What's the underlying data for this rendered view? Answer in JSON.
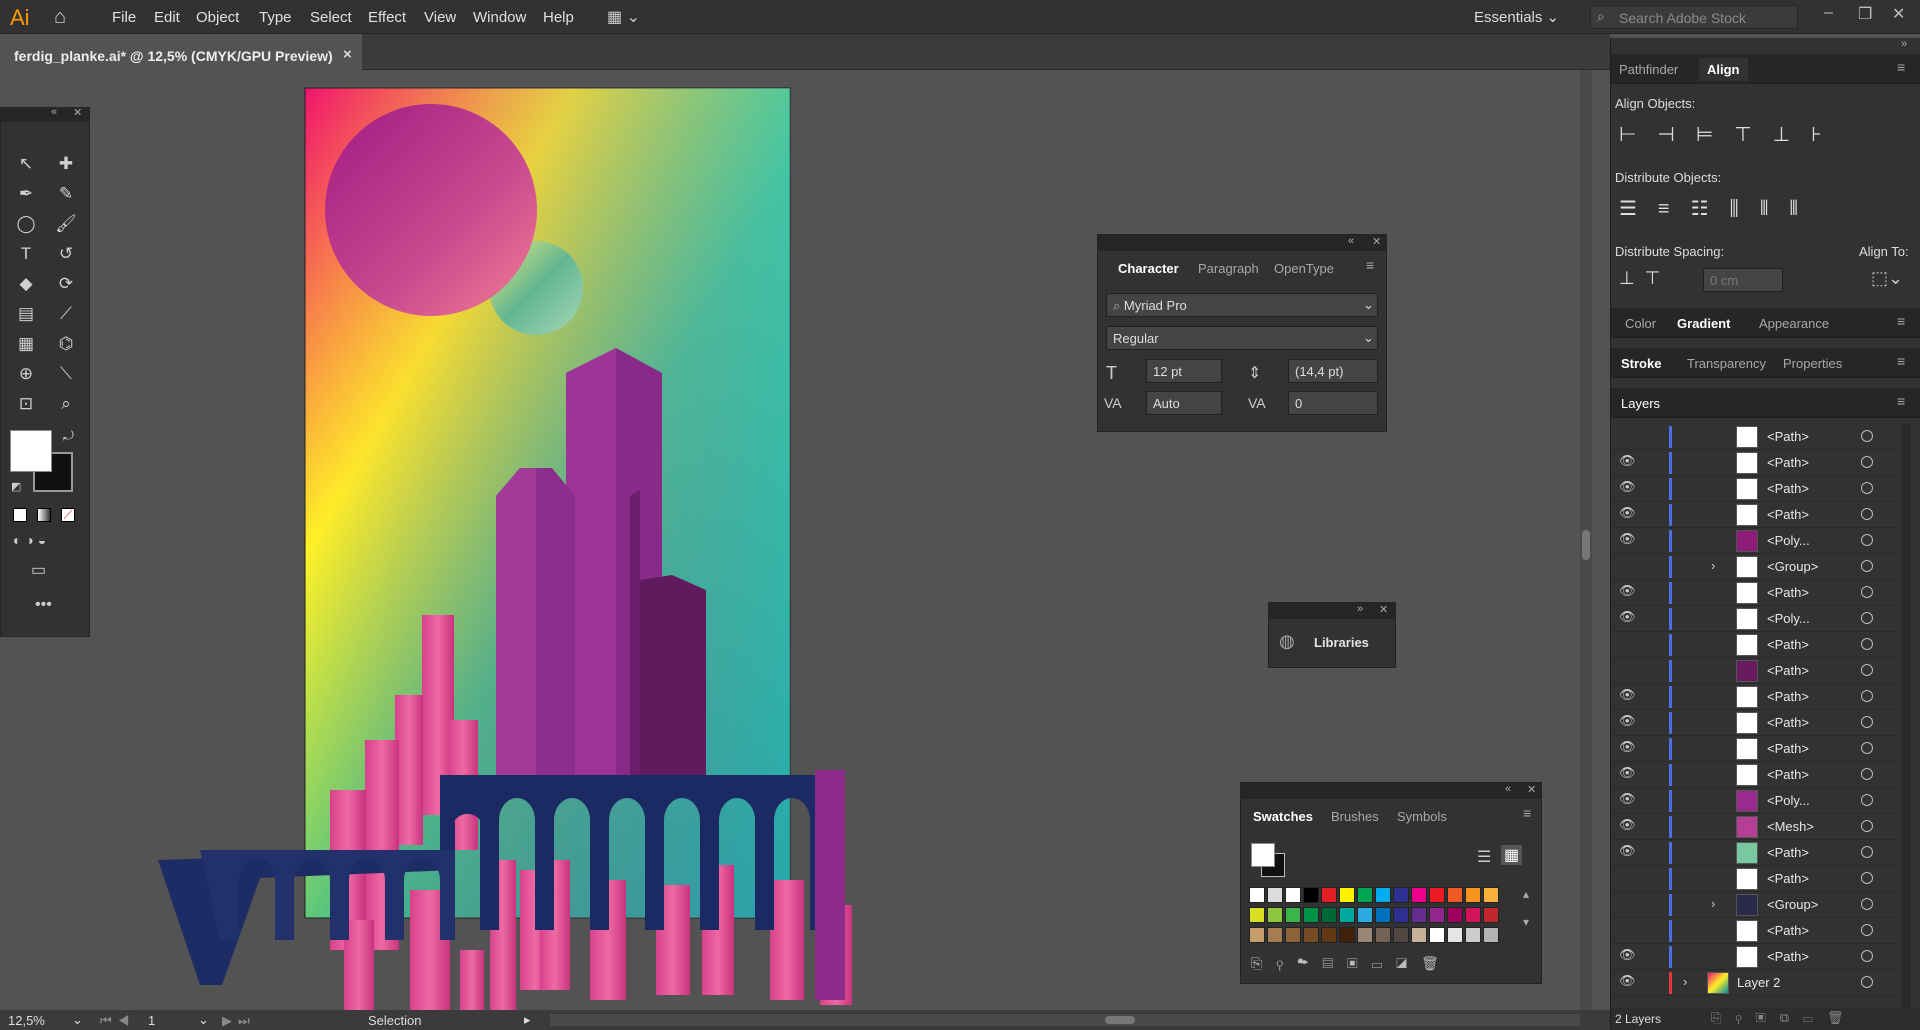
{
  "app": {
    "logo": "Ai",
    "workspace": "Essentials",
    "search_placeholder": "Search Adobe Stock"
  },
  "menu": [
    "File",
    "Edit",
    "Object",
    "Type",
    "Select",
    "Effect",
    "View",
    "Window",
    "Help"
  ],
  "document": {
    "tab_title": "ferdig_planke.ai* @ 12,5% (CMYK/GPU Preview)",
    "close": "×"
  },
  "status": {
    "zoom": "12,5%",
    "artboard": "1",
    "tool": "Selection"
  },
  "character": {
    "tabs": [
      "Character",
      "Paragraph",
      "OpenType"
    ],
    "font_family": "Myriad Pro",
    "font_style": "Regular",
    "font_size": "12 pt",
    "leading": "(14,4 pt)",
    "kerning": "Auto",
    "tracking": "0"
  },
  "libraries": {
    "label": "Libraries"
  },
  "swatches": {
    "tabs": [
      "Swatches",
      "Brushes",
      "Symbols"
    ]
  },
  "dock": {
    "top_tabs": [
      "Pathfinder",
      "Align"
    ],
    "align_objects": "Align Objects:",
    "distribute_objects": "Distribute Objects:",
    "distribute_spacing": "Distribute Spacing:",
    "align_to": "Align To:",
    "spacing_value": "0 cm",
    "color_tabs": [
      "Color",
      "Gradient",
      "Appearance"
    ],
    "stroke_tabs": [
      "Stroke",
      "Transparency",
      "Properties"
    ],
    "layers_tab": "Layers",
    "layers_count": "2 Layers"
  },
  "layers": [
    {
      "name": "<Path>",
      "eye": false,
      "arrow": false
    },
    {
      "name": "<Path>",
      "eye": true,
      "arrow": false
    },
    {
      "name": "<Path>",
      "eye": true,
      "arrow": false
    },
    {
      "name": "<Path>",
      "eye": true,
      "arrow": false
    },
    {
      "name": "<Poly...",
      "eye": true,
      "arrow": false
    },
    {
      "name": "<Group>",
      "eye": false,
      "arrow": true
    },
    {
      "name": "<Path>",
      "eye": true,
      "arrow": false
    },
    {
      "name": "<Poly...",
      "eye": true,
      "arrow": false
    },
    {
      "name": "<Path>",
      "eye": false,
      "arrow": false
    },
    {
      "name": "<Path>",
      "eye": false,
      "arrow": false
    },
    {
      "name": "<Path>",
      "eye": true,
      "arrow": false
    },
    {
      "name": "<Path>",
      "eye": true,
      "arrow": false
    },
    {
      "name": "<Path>",
      "eye": true,
      "arrow": false
    },
    {
      "name": "<Path>",
      "eye": true,
      "arrow": false
    },
    {
      "name": "<Poly...",
      "eye": true,
      "arrow": false
    },
    {
      "name": "<Mesh>",
      "eye": true,
      "arrow": false
    },
    {
      "name": "<Path>",
      "eye": true,
      "arrow": false
    },
    {
      "name": "<Path>",
      "eye": false,
      "arrow": false
    },
    {
      "name": "<Group>",
      "eye": false,
      "arrow": true
    },
    {
      "name": "<Path>",
      "eye": false,
      "arrow": false
    },
    {
      "name": "<Path>",
      "eye": true,
      "arrow": false
    }
  ],
  "layer2": "Layer 2"
}
